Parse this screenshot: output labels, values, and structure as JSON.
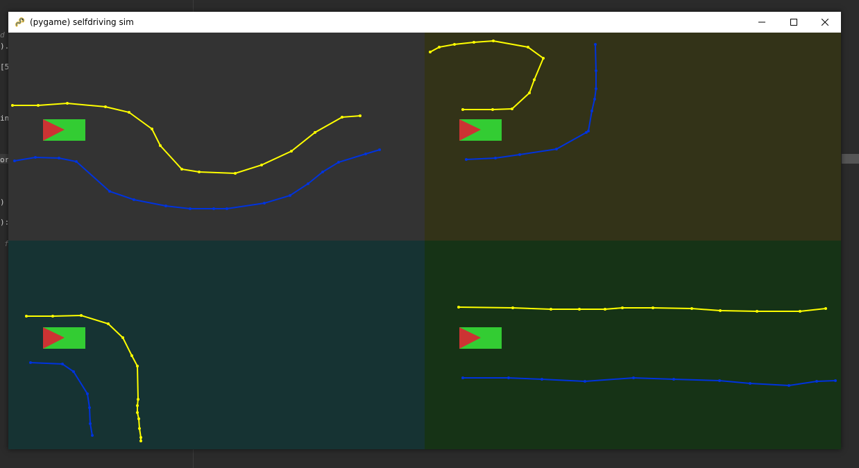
{
  "window": {
    "title": "(pygame) selfdriving sim",
    "icons": {
      "app": "pygame-snake-icon",
      "minimize": "minimize-icon",
      "maximize": "maximize-icon",
      "close": "close-icon"
    }
  },
  "editor_fragments": [
    "d",
    ").",
    "[5",
    "in",
    "or",
    ")",
    "):",
    "f"
  ],
  "colors": {
    "left_boundary": "#ffff00",
    "right_boundary": "#0033dd",
    "car_body": "#33cc33",
    "car_arrow": "#cc3333",
    "panel_backgrounds": [
      "#333333",
      "#333318",
      "#163333",
      "#163316"
    ]
  },
  "panels": [
    {
      "name": "top-left",
      "left": [
        [
          6,
          105
        ],
        [
          43,
          105
        ],
        [
          85,
          102
        ],
        [
          140,
          107
        ],
        [
          174,
          115
        ],
        [
          207,
          139
        ],
        [
          219,
          163
        ],
        [
          250,
          197
        ],
        [
          275,
          201
        ],
        [
          327,
          203
        ],
        [
          365,
          191
        ],
        [
          408,
          171
        ],
        [
          442,
          144
        ],
        [
          481,
          122
        ],
        [
          507,
          120
        ]
      ],
      "right": [
        [
          9,
          185
        ],
        [
          39,
          180
        ],
        [
          73,
          181
        ],
        [
          98,
          186
        ],
        [
          146,
          229
        ],
        [
          181,
          241
        ],
        [
          227,
          250
        ],
        [
          262,
          254
        ],
        [
          296,
          254
        ],
        [
          315,
          254
        ],
        [
          369,
          246
        ],
        [
          406,
          235
        ],
        [
          432,
          218
        ],
        [
          453,
          201
        ],
        [
          476,
          187
        ],
        [
          515,
          175
        ],
        [
          535,
          169
        ]
      ]
    },
    {
      "name": "top-right",
      "left": [
        [
          8,
          28
        ],
        [
          21,
          21
        ],
        [
          43,
          17
        ],
        [
          71,
          14
        ],
        [
          99,
          12
        ],
        [
          149,
          21
        ],
        [
          171,
          37
        ],
        [
          158,
          68
        ],
        [
          151,
          87
        ],
        [
          126,
          110
        ],
        [
          98,
          111
        ],
        [
          55,
          111
        ]
      ],
      "right": [
        [
          246,
          17
        ],
        [
          247,
          55
        ],
        [
          247,
          81
        ],
        [
          245,
          96
        ],
        [
          241,
          113
        ],
        [
          236,
          142
        ],
        [
          233,
          144
        ],
        [
          190,
          168
        ],
        [
          137,
          176
        ],
        [
          102,
          181
        ],
        [
          60,
          183
        ]
      ]
    },
    {
      "name": "bottom-left",
      "left": [
        [
          26,
          109
        ],
        [
          64,
          109
        ],
        [
          105,
          108
        ],
        [
          144,
          120
        ],
        [
          165,
          140
        ],
        [
          178,
          166
        ],
        [
          186,
          181
        ],
        [
          187,
          229
        ],
        [
          186,
          238
        ],
        [
          186,
          248
        ],
        [
          188,
          257
        ],
        [
          189,
          271
        ],
        [
          191,
          284
        ],
        [
          191,
          289
        ]
      ],
      "right": [
        [
          32,
          176
        ],
        [
          78,
          178
        ],
        [
          94,
          189
        ],
        [
          114,
          221
        ],
        [
          117,
          241
        ],
        [
          118,
          264
        ],
        [
          121,
          281
        ]
      ]
    },
    {
      "name": "bottom-right",
      "left": [
        [
          49,
          96
        ],
        [
          127,
          97
        ],
        [
          182,
          99
        ],
        [
          223,
          99
        ],
        [
          260,
          99
        ],
        [
          285,
          97
        ],
        [
          329,
          97
        ],
        [
          385,
          98
        ],
        [
          426,
          101
        ],
        [
          479,
          102
        ],
        [
          541,
          102
        ],
        [
          578,
          98
        ]
      ],
      "right": [
        [
          55,
          198
        ],
        [
          121,
          198
        ],
        [
          169,
          200
        ],
        [
          231,
          203
        ],
        [
          301,
          198
        ],
        [
          359,
          200
        ],
        [
          425,
          202
        ],
        [
          469,
          206
        ],
        [
          525,
          209
        ],
        [
          565,
          203
        ],
        [
          592,
          202
        ]
      ]
    }
  ]
}
